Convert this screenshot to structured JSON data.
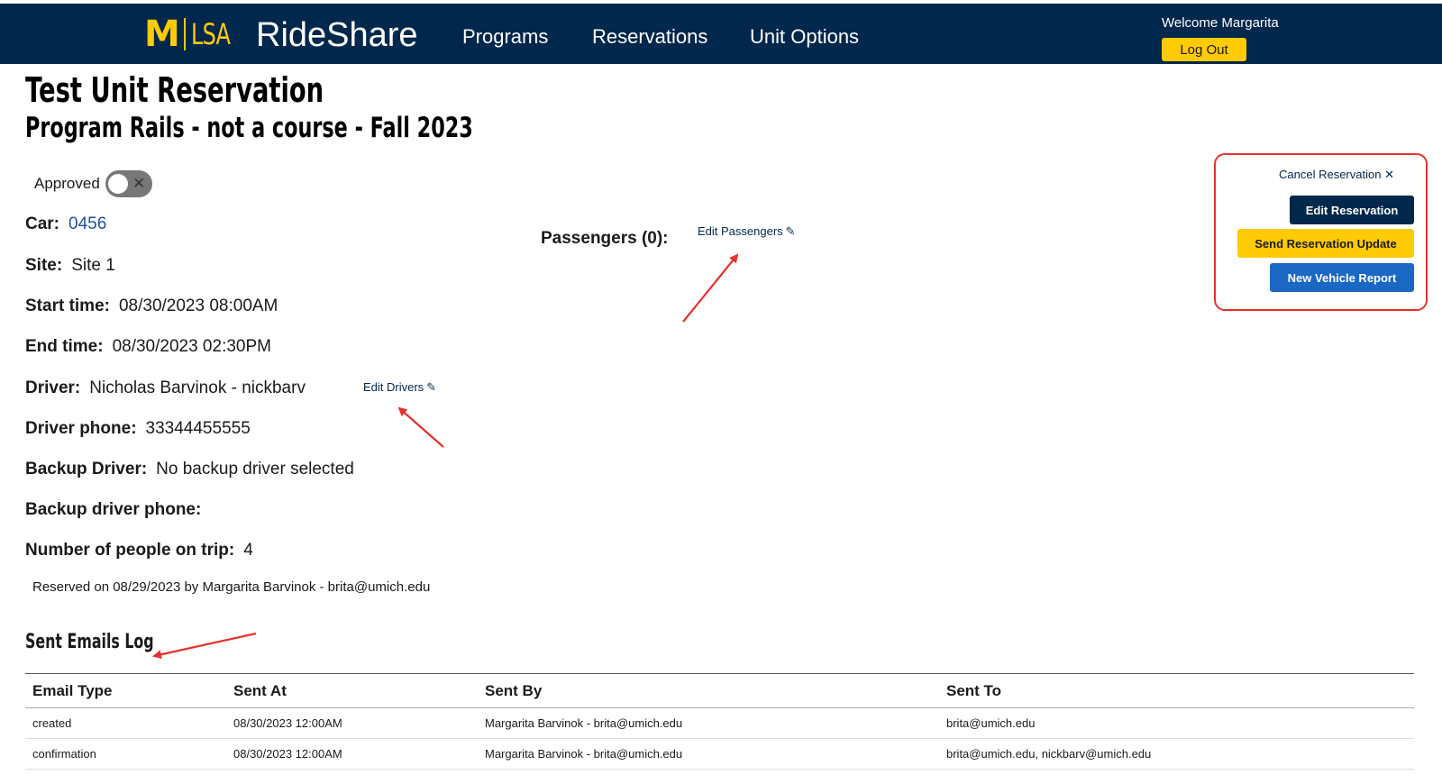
{
  "header": {
    "logo_m": "M",
    "logo_lsa": "LSA",
    "app_name": "RideShare",
    "nav": [
      "Programs",
      "Reservations",
      "Unit Options"
    ],
    "welcome": "Welcome Margarita",
    "logout_label": "Log Out"
  },
  "page": {
    "title": "Test Unit Reservation",
    "subtitle": "Program Rails - not a course - Fall 2023"
  },
  "approval": {
    "label": "Approved",
    "toggle_icon": "✕"
  },
  "details": {
    "car_label": "Car:",
    "car_value": "0456",
    "site_label": "Site:",
    "site_value": "Site 1",
    "start_label": "Start time:",
    "start_value": "08/30/2023 08:00AM",
    "end_label": "End time:",
    "end_value": "08/30/2023 02:30PM",
    "driver_label": "Driver:",
    "driver_value": "Nicholas Barvinok - nickbarv",
    "edit_drivers": "Edit Drivers",
    "driver_phone_label": "Driver phone:",
    "driver_phone_value": "33344455555",
    "backup_driver_label": "Backup Driver:",
    "backup_driver_value": "No backup driver selected",
    "backup_phone_label": "Backup driver phone:",
    "backup_phone_value": "",
    "people_label": "Number of people on trip:",
    "people_value": "4",
    "reserved_on": "Reserved on 08/29/2023 by Margarita Barvinok - brita@umich.edu"
  },
  "passengers": {
    "label": "Passengers (0):",
    "edit_label": "Edit Passengers"
  },
  "actions": {
    "cancel_label": "Cancel Reservation",
    "cancel_icon": "✕",
    "edit_label": "Edit Reservation",
    "update_label": "Send Reservation Update",
    "report_label": "New Vehicle Report"
  },
  "emails_log": {
    "title": "Sent Emails Log",
    "columns": [
      "Email Type",
      "Sent At",
      "Sent By",
      "Sent To"
    ],
    "rows": [
      [
        "created",
        "08/30/2023 12:00AM",
        "Margarita Barvinok - brita@umich.edu",
        "brita@umich.edu"
      ],
      [
        "confirmation",
        "08/30/2023 12:00AM",
        "Margarita Barvinok - brita@umich.edu",
        "brita@umich.edu, nickbarv@umich.edu"
      ]
    ]
  },
  "colors": {
    "navy": "#00274c",
    "maize": "#ffcb05",
    "link_blue": "#1f4fa0",
    "report_blue": "#1a68c4",
    "annotation_red": "#e5322d"
  },
  "icons": {
    "pencil": "✎"
  }
}
